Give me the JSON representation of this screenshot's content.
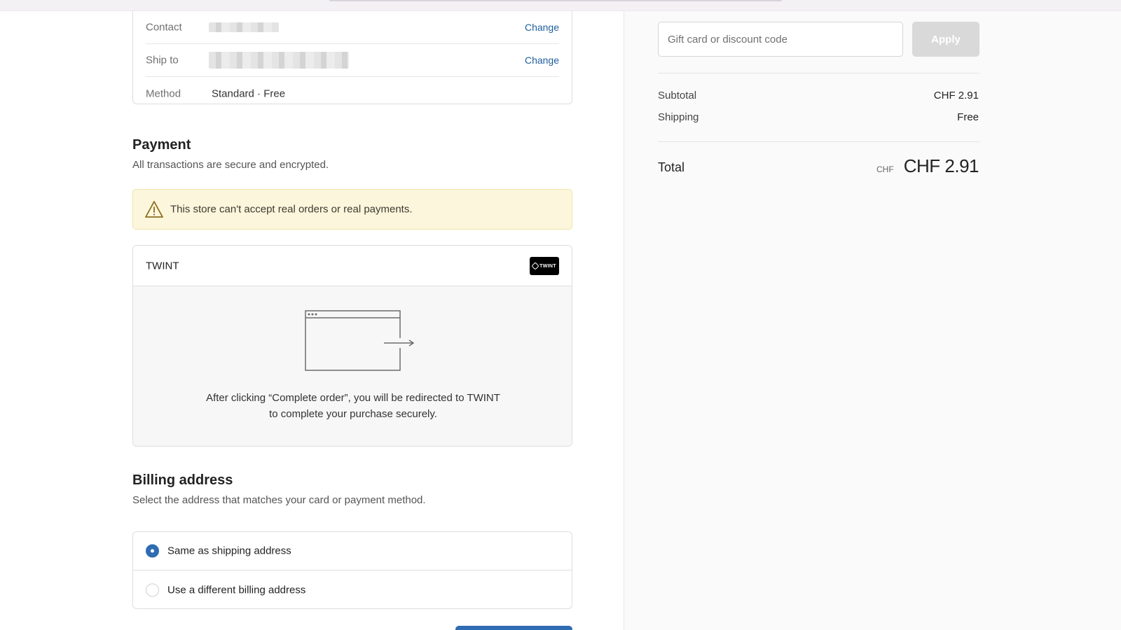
{
  "review": {
    "contact_label": "Contact",
    "contact_change": "Change",
    "ship_label": "Ship to",
    "ship_change": "Change",
    "method_label": "Method",
    "method_value": "Standard · Free"
  },
  "payment": {
    "title": "Payment",
    "subtitle": "All transactions are secure and encrypted.",
    "alert": "This store can't accept real orders or real payments.",
    "method_name": "TWINT",
    "logo_text": "TWINT",
    "redirect_line1": "After clicking “Complete order”, you will be redirected to TWINT",
    "redirect_line2": "to complete your purchase securely."
  },
  "billing": {
    "title": "Billing address",
    "subtitle": "Select the address that matches your card or payment method.",
    "options": [
      {
        "label": "Same as shipping address",
        "selected": true
      },
      {
        "label": "Use a different billing address",
        "selected": false
      }
    ]
  },
  "summary": {
    "discount_placeholder": "Gift card or discount code",
    "apply_label": "Apply",
    "subtotal_label": "Subtotal",
    "subtotal_value": "CHF 2.91",
    "shipping_label": "Shipping",
    "shipping_value": "Free",
    "total_label": "Total",
    "total_currency": "CHF",
    "total_value": "CHF 2.91"
  },
  "colors": {
    "accent": "#2f6cb1",
    "link": "#1f5f9e",
    "warning_bg": "#fcf6dc"
  }
}
